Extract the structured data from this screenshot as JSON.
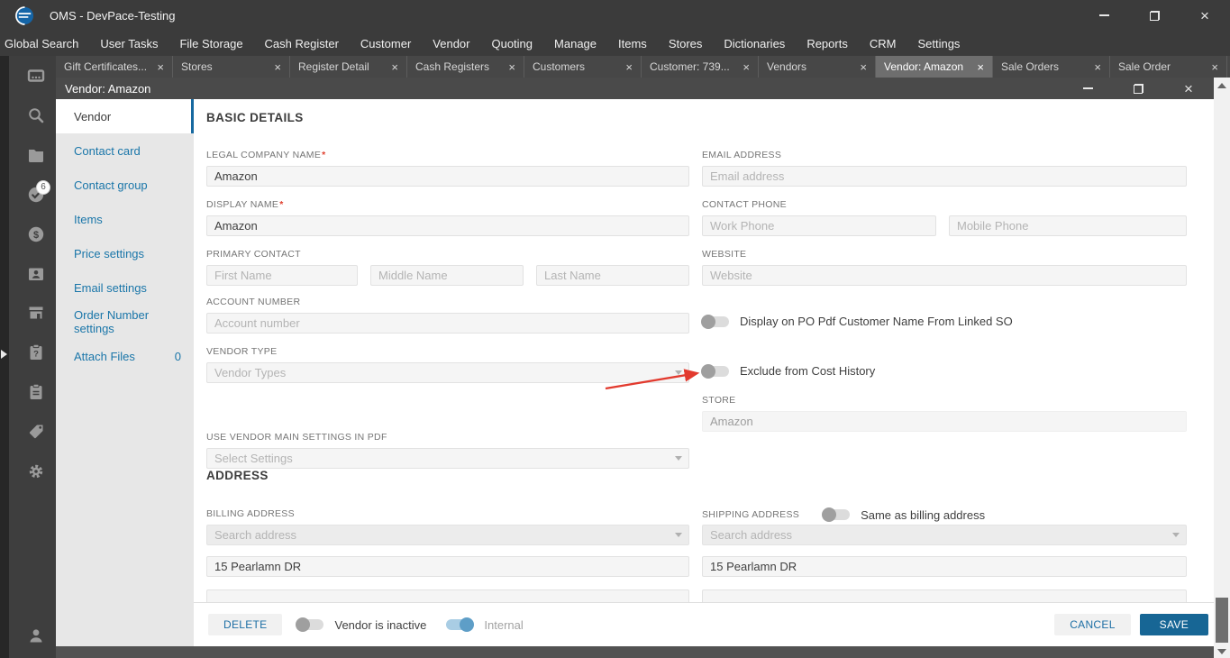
{
  "colors": {
    "titlebar_bg": "#3b3b3b",
    "inner_titlebar_bg": "#4a4a4a",
    "nav_link_blue": "#1a76a9",
    "accent_blue": "#176695",
    "toggle_on_blue": "#5e9ec7",
    "required_red": "#e0402f",
    "callout_arrow_red": "#e23a2e"
  },
  "glyphs": {
    "close": "×"
  },
  "titlebar": {
    "title": "OMS - DevPace-Testing"
  },
  "menubar": {
    "items": [
      "Global Search",
      "User Tasks",
      "File Storage",
      "Cash Register",
      "Customer",
      "Vendor",
      "Quoting",
      "Manage",
      "Items",
      "Stores",
      "Dictionaries",
      "Reports",
      "CRM",
      "Settings"
    ]
  },
  "tabs": [
    {
      "label": "Gift Certificates...",
      "active": false
    },
    {
      "label": "Stores",
      "active": false
    },
    {
      "label": "Register Detail",
      "active": false
    },
    {
      "label": "Cash Registers",
      "active": false
    },
    {
      "label": "Customers",
      "active": false
    },
    {
      "label": "Customer: 739...",
      "active": false
    },
    {
      "label": "Vendors",
      "active": false
    },
    {
      "label": "Vendor: Amazon",
      "active": true
    },
    {
      "label": "Sale Orders",
      "active": false
    },
    {
      "label": "Sale Order",
      "active": false
    }
  ],
  "sidebar": {
    "task_badge": "6",
    "icons": [
      "register",
      "search",
      "folder",
      "tasks-check",
      "finance-dollar",
      "contact-card",
      "store",
      "clipboard-question",
      "clipboard-list",
      "tag",
      "settings-gear",
      "user"
    ]
  },
  "inner_window": {
    "title": "Vendor: Amazon"
  },
  "nav": {
    "items": [
      {
        "label": "Vendor",
        "active": true
      },
      {
        "label": "Contact card"
      },
      {
        "label": "Contact group"
      },
      {
        "label": "Items"
      },
      {
        "label": "Price settings"
      },
      {
        "label": "Email settings"
      },
      {
        "label": "Order Number settings"
      },
      {
        "label": "Attach Files",
        "count": "0"
      }
    ]
  },
  "form": {
    "required_marker": "*",
    "sections": {
      "basic": "BASIC DETAILS",
      "address": "ADDRESS"
    },
    "legal_company_name": {
      "label": "LEGAL COMPANY NAME",
      "value": "Amazon",
      "required": true
    },
    "display_name": {
      "label": "DISPLAY NAME",
      "value": "Amazon",
      "required": true
    },
    "primary_contact": {
      "label": "PRIMARY CONTACT",
      "first_placeholder": "First Name",
      "middle_placeholder": "Middle Name",
      "last_placeholder": "Last Name"
    },
    "account_number": {
      "label": "ACCOUNT NUMBER",
      "placeholder": "Account number"
    },
    "vendor_type": {
      "label": "VENDOR TYPE",
      "placeholder": "Vendor Types"
    },
    "pdf_settings": {
      "label": "USE VENDOR MAIN SETTINGS IN PDF",
      "placeholder": "Select Settings"
    },
    "email": {
      "label": "EMAIL ADDRESS",
      "placeholder": "Email address"
    },
    "contact_phone": {
      "label": "CONTACT PHONE",
      "work_placeholder": "Work Phone",
      "mobile_placeholder": "Mobile Phone"
    },
    "website": {
      "label": "WEBSITE",
      "placeholder": "Website"
    },
    "toggle_po_pdf": {
      "label": "Display on PO Pdf Customer Name From Linked SO",
      "state": "off"
    },
    "toggle_exclude_cost": {
      "label": "Exclude from Cost History",
      "state": "off",
      "highlighted_by_arrow": true
    },
    "store": {
      "label": "STORE",
      "value": "Amazon"
    },
    "billing": {
      "label": "BILLING ADDRESS",
      "search_placeholder": "Search address",
      "line1": "15 Pearlamn DR"
    },
    "shipping": {
      "label": "SHIPPING ADDRESS",
      "same_toggle_label": "Same as billing address",
      "same_toggle_state": "off",
      "search_placeholder": "Search address",
      "line1": "15 Pearlamn DR"
    }
  },
  "footer": {
    "delete_label": "DELETE",
    "vendor_inactive_label": "Vendor is inactive",
    "vendor_inactive_state": "off",
    "internal_label": "Internal",
    "internal_state": "on",
    "cancel_label": "CANCEL",
    "save_label": "SAVE"
  }
}
